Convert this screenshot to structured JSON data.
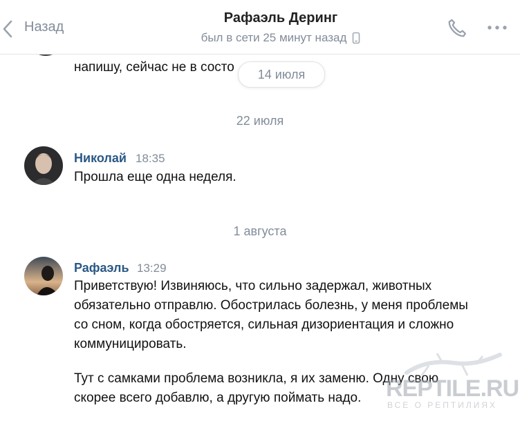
{
  "header": {
    "back_label": "Назад",
    "contact_name": "Рафаэль Деринг",
    "status": "был в сети 25 минут назад"
  },
  "chat": {
    "previous_message_line": "напишу, сейчас не в состо",
    "floating_date": "14 июля",
    "groups": [
      {
        "date": "22 июля",
        "author": "Николай",
        "time": "18:35",
        "paragraphs": [
          "Прошла еще одна неделя."
        ]
      },
      {
        "date": "1 августа",
        "author": "Рафаэль",
        "time": "13:29",
        "paragraphs": [
          "Приветствую! Извиняюсь, что сильно задержал, животных обязательно отправлю. Обострилась болезнь, у меня проблемы со сном, когда обостряется, сильная дизориентация и сложно коммуницировать.",
          "Тут с самками проблема возникла, я их заменю. Одну свою скорее всего добавлю, а другую поймать надо."
        ]
      }
    ]
  },
  "watermark": {
    "text": "REPTILE.RU",
    "subtext": "ВСЕ О РЕПТИЛИЯХ"
  },
  "colors": {
    "accent": "#2a5885",
    "secondary_text": "#818c99",
    "icon": "#99a2ad"
  },
  "icons": {
    "back": "chevron-left-icon",
    "call": "phone-icon",
    "more": "more-dots-icon",
    "online_device": "mobile-phone-icon"
  }
}
